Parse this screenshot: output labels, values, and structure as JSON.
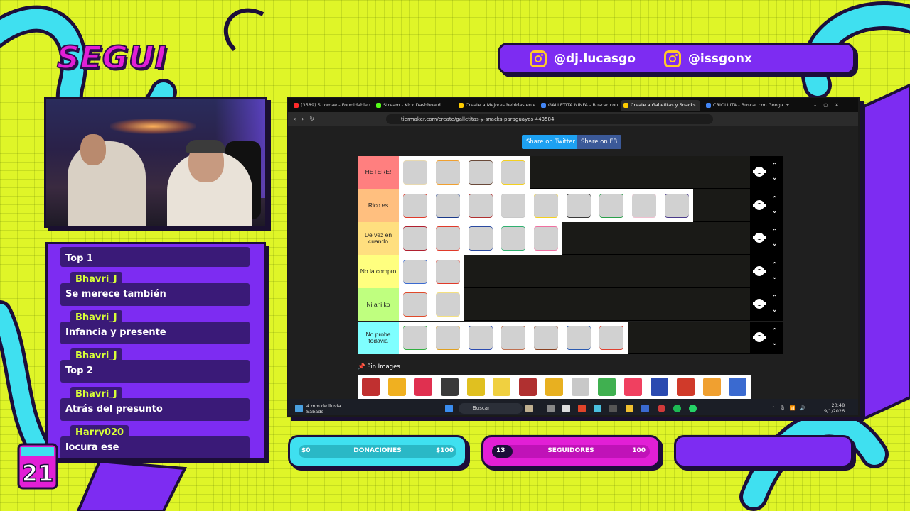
{
  "overlay": {
    "title": "SEGUI",
    "socials": [
      {
        "icon": "instagram-icon",
        "handle": "@dj.lucasgo"
      },
      {
        "icon": "instagram-icon",
        "handle": "@issgonx"
      }
    ],
    "colors": {
      "accent": "#7d2cf2",
      "background": "#dff528",
      "dark": "#1c0d3a",
      "cyan": "#3fe0f0",
      "magenta": "#e21fd6"
    }
  },
  "chat": {
    "messages": [
      {
        "user": "",
        "text": "Top 1"
      },
      {
        "user": "Bhavri_J",
        "text": "Se merece también"
      },
      {
        "user": "Bhavri_J",
        "text": "Infancia y presente"
      },
      {
        "user": "Bhavri_J",
        "text": "Top 2"
      },
      {
        "user": "Bhavri_J",
        "text": "Atrás del presunto"
      },
      {
        "user": "Harry020",
        "text": "locura ese"
      }
    ]
  },
  "browser": {
    "tabs": [
      {
        "label": "(3589) Stromae - Formidable (Li...",
        "color": "#ff2a2a"
      },
      {
        "label": "Stream - Kick Dashboard",
        "color": "#53fc18"
      },
      {
        "label": "Create a Mejores bebidas en el ...",
        "color": "#ffcc00"
      },
      {
        "label": "GALLETITA NINFA - Buscar con ...",
        "color": "#4285f4"
      },
      {
        "label": "Create a Galletitas y Snacks ...",
        "color": "#ffcc00"
      },
      {
        "label": "CRIOLLITA - Buscar con Google",
        "color": "#4285f4"
      }
    ],
    "url": "tiermaker.com/create/galletitas-y-snacks-paraguayos-443584",
    "share_twitter": "Share on Twitter",
    "share_fb": "Share on FB",
    "tiers": [
      {
        "label": "HETERE!",
        "color": "#ff7f7f",
        "items": [
          "#e8d9b0",
          "#f0a030",
          "#6a4a3a",
          "#f4d020"
        ]
      },
      {
        "label": "Rico es",
        "color": "#ffbf7f",
        "items": [
          "#e03a2a",
          "#1a3a8a",
          "#b03030",
          "#c8c8c8",
          "#f4d020",
          "#3a3a3a",
          "#2aa04a",
          "#f0c0d0",
          "#4a3a8a"
        ]
      },
      {
        "label": "De vez en cuando",
        "color": "#ffdf7f",
        "items": [
          "#b02030",
          "#e03a2a",
          "#2a4aa0",
          "#30b070",
          "#f070a0"
        ]
      },
      {
        "label": "No la compro",
        "color": "#ffff7f",
        "items": [
          "#3a6ad0",
          "#e03a2a"
        ]
      },
      {
        "label": "Ni ahi ko",
        "color": "#bfff7f",
        "items": [
          "#e04a2a",
          "#f4e080"
        ]
      },
      {
        "label": "No probe todavia",
        "color": "#7fffff",
        "items": [
          "#30b040",
          "#e0a020",
          "#2a4ab0",
          "#c07050",
          "#8a4020",
          "#2a5ab0",
          "#e04030"
        ]
      }
    ],
    "pin_label": "Pin Images",
    "pin_items": [
      "#c03030",
      "#f0b020",
      "#e03050",
      "#3a3a3a",
      "#e0c020",
      "#f0d040",
      "#b03030",
      "#e8b020",
      "#c8c8c8",
      "#40b050",
      "#f04060",
      "#2a4ab0",
      "#d03a2a",
      "#f0a030",
      "#3a6ad0"
    ],
    "taskbar": {
      "weather_line1": "4 mm de lluvia",
      "weather_line2": "Sábado",
      "search": "Buscar",
      "time": "20:48",
      "date": "9/1/2026"
    }
  },
  "bars": {
    "donaciones": {
      "label": "DONACIONES",
      "start": "$0",
      "end": "$100",
      "progress": 0
    },
    "seguidores": {
      "label": "SEGUIDORES",
      "start": "13",
      "end": "100",
      "progress": 0.13
    }
  }
}
